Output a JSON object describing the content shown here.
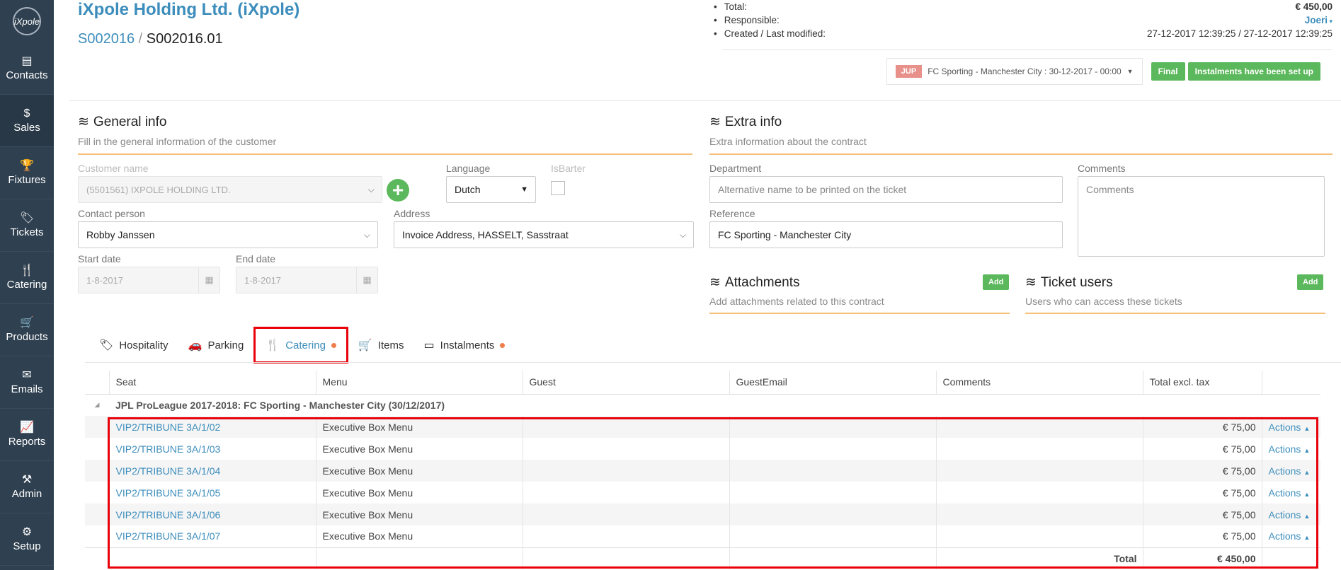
{
  "sidebar": {
    "logo": "iXpole",
    "items": [
      {
        "label": "Contacts",
        "icon": "▤"
      },
      {
        "label": "Sales",
        "icon": "$"
      },
      {
        "label": "Fixtures",
        "icon": "🏆"
      },
      {
        "label": "Tickets",
        "icon": "🏷"
      },
      {
        "label": "Catering",
        "icon": "🍴"
      },
      {
        "label": "Products",
        "icon": "🛒"
      },
      {
        "label": "Emails",
        "icon": "✉"
      },
      {
        "label": "Reports",
        "icon": "📈"
      },
      {
        "label": "Admin",
        "icon": "⚒"
      },
      {
        "label": "Setup",
        "icon": "⚙"
      }
    ]
  },
  "header": {
    "company": "iXpole Holding Ltd. (iXpole)",
    "breadcrumb": {
      "parent": "S002016",
      "sep": "/",
      "current": "S002016.01"
    }
  },
  "summary": {
    "total_label": "Total:",
    "total_value": "€ 450,00",
    "responsible_label": "Responsible:",
    "responsible_value": "Joeri",
    "created_label": "Created / Last modified:",
    "created_value": "27-12-2017 12:39:25 / 27-12-2017 12:39:25"
  },
  "status": {
    "badge": "JUP",
    "event": "FC Sporting - Manchester City : 30-12-2017 - 00:00",
    "final": "Final",
    "instalments": "Instalments have been set up"
  },
  "general": {
    "title": "General info",
    "subtitle": "Fill in the general information of the customer",
    "customer_label": "Customer name",
    "customer_value": "(5501561) IXPOLE HOLDING LTD.",
    "language_label": "Language",
    "language_value": "Dutch",
    "isbarter_label": "IsBarter",
    "contact_label": "Contact person",
    "contact_value": "Robby Janssen",
    "address_label": "Address",
    "address_value": "Invoice Address, HASSELT, Sasstraat",
    "start_label": "Start date",
    "start_value": "1-8-2017",
    "end_label": "End date",
    "end_value": "1-8-2017"
  },
  "extra": {
    "title": "Extra info",
    "subtitle": "Extra information about the contract",
    "department_label": "Department",
    "department_placeholder": "Alternative name to be printed on the ticket",
    "comments_label": "Comments",
    "comments_placeholder": "Comments",
    "reference_label": "Reference",
    "reference_value": "FC Sporting - Manchester City"
  },
  "attachments": {
    "title": "Attachments",
    "subtitle": "Add attachments related to this contract",
    "add": "Add"
  },
  "ticket_users": {
    "title": "Ticket users",
    "subtitle": "Users who can access these tickets",
    "add": "Add"
  },
  "tabs": [
    {
      "label": "Hospitality"
    },
    {
      "label": "Parking"
    },
    {
      "label": "Catering"
    },
    {
      "label": "Items"
    },
    {
      "label": "Instalments"
    }
  ],
  "table": {
    "columns": [
      "Seat",
      "Menu",
      "Guest",
      "GuestEmail",
      "Comments",
      "Total excl. tax"
    ],
    "group": "JPL ProLeague 2017-2018: FC Sporting - Manchester City (30/12/2017)",
    "rows": [
      {
        "seat": "VIP2/TRIBUNE 3A/1/02",
        "menu": "Executive Box Menu",
        "total": "€ 75,00",
        "action": "Actions"
      },
      {
        "seat": "VIP2/TRIBUNE 3A/1/03",
        "menu": "Executive Box Menu",
        "total": "€ 75,00",
        "action": "Actions"
      },
      {
        "seat": "VIP2/TRIBUNE 3A/1/04",
        "menu": "Executive Box Menu",
        "total": "€ 75,00",
        "action": "Actions"
      },
      {
        "seat": "VIP2/TRIBUNE 3A/1/05",
        "menu": "Executive Box Menu",
        "total": "€ 75,00",
        "action": "Actions"
      },
      {
        "seat": "VIP2/TRIBUNE 3A/1/06",
        "menu": "Executive Box Menu",
        "total": "€ 75,00",
        "action": "Actions"
      },
      {
        "seat": "VIP2/TRIBUNE 3A/1/07",
        "menu": "Executive Box Menu",
        "total": "€ 75,00",
        "action": "Actions"
      }
    ],
    "total_label": "Total",
    "total_value": "€ 450,00"
  }
}
